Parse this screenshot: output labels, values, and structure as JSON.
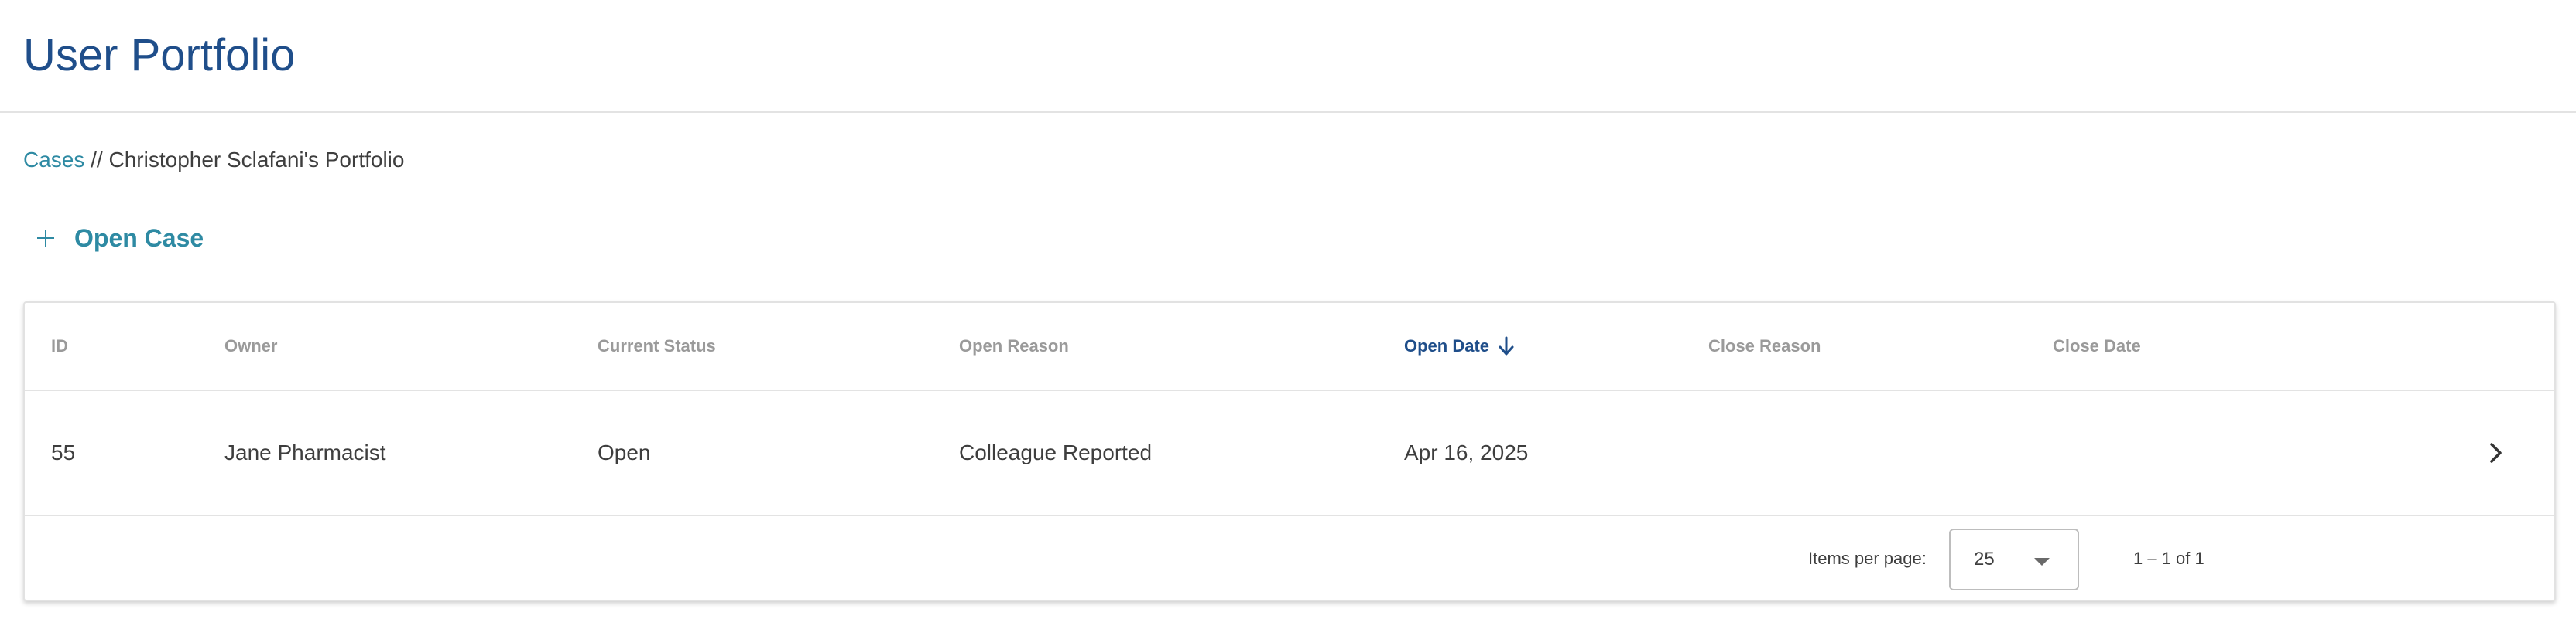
{
  "page": {
    "title": "User Portfolio"
  },
  "breadcrumb": {
    "link": "Cases",
    "separator": " // ",
    "current": "Christopher Sclafani's Portfolio"
  },
  "actions": {
    "open_case_label": "Open Case",
    "open_case_icon": "plus-icon"
  },
  "table": {
    "columns": [
      "ID",
      "Owner",
      "Current Status",
      "Open Reason",
      "Open Date",
      "Close Reason",
      "Close Date"
    ],
    "sorted_column": "Open Date",
    "sort_direction": "descending",
    "rows": [
      {
        "id": "55",
        "owner": "Jane Pharmacist",
        "current_status": "Open",
        "open_reason": "Colleague Reported",
        "open_date": "Apr 16, 2025",
        "close_reason": "",
        "close_date": ""
      }
    ]
  },
  "pagination": {
    "items_per_page_label": "Items per page:",
    "items_per_page": "25",
    "range": "1 – 1 of 1"
  },
  "colors": {
    "title": "#1f4e8a",
    "accent": "#2e8aa3",
    "header_text": "#9a9a9a"
  }
}
